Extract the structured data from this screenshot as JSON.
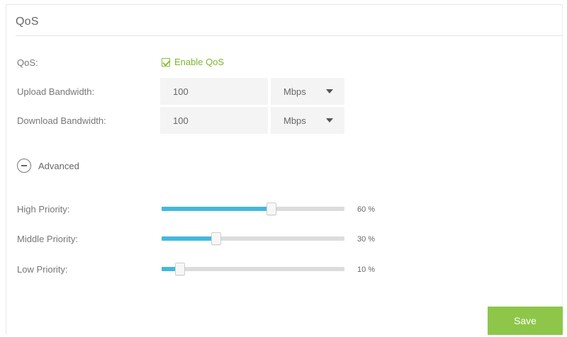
{
  "page": {
    "title": "QoS"
  },
  "qos": {
    "label": "QoS:",
    "enable_label": "Enable QoS",
    "enabled": true
  },
  "upload": {
    "label": "Upload Bandwidth:",
    "value": "100",
    "unit": "Mbps"
  },
  "download": {
    "label": "Download Bandwidth:",
    "value": "100",
    "unit": "Mbps"
  },
  "advanced": {
    "label": "Advanced",
    "icon": "collapse-minus-icon"
  },
  "priorities": [
    {
      "label": "High Priority:",
      "value": 60,
      "value_text": "60 %"
    },
    {
      "label": "Middle Priority:",
      "value": 30,
      "value_text": "30 %"
    },
    {
      "label": "Low Priority:",
      "value": 10,
      "value_text": "10 %"
    }
  ],
  "actions": {
    "save_label": "Save"
  },
  "colors": {
    "accent_green": "#8ec64a",
    "slider_fill": "#42b8dd",
    "input_bg": "#f4f4f4"
  }
}
